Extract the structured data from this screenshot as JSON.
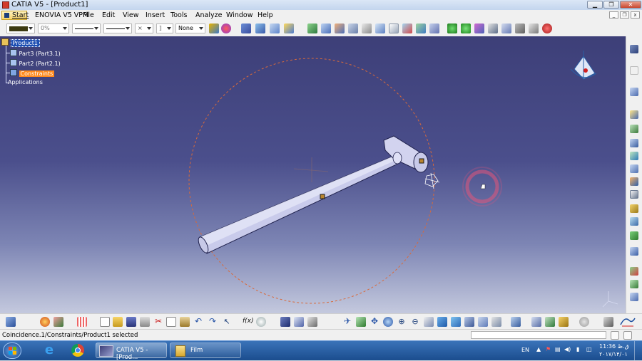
{
  "window": {
    "title": "CATIA V5 - [Product1]"
  },
  "menu": {
    "start": "Start",
    "items": [
      "ENOVIA V5 VPM",
      "File",
      "Edit",
      "View",
      "Insert",
      "Tools",
      "Analyze",
      "Window",
      "Help"
    ]
  },
  "toolbar": {
    "transparency": "0%",
    "layer": "None"
  },
  "tree": {
    "root": "Product1",
    "part3": "Part3 (Part3.1)",
    "part2": "Part2 (Part2.1)",
    "constraints": "Constraints",
    "applications": "Applications"
  },
  "status": {
    "message": "Coincidence.1/Constraints/Product1 selected"
  },
  "taskbar": {
    "apps": [
      {
        "label": "CATIA V5 - [Prod..."
      },
      {
        "label": "Film"
      }
    ],
    "language": "EN",
    "time": "11:36 ق.ظ",
    "date": "۲۰۱۷/۱۴/۰۱"
  },
  "colors": {
    "accent_orange": "#ff8a1d",
    "selection_blue": "#1e4fb3",
    "taskbar_blue": "#1b4d8e"
  }
}
